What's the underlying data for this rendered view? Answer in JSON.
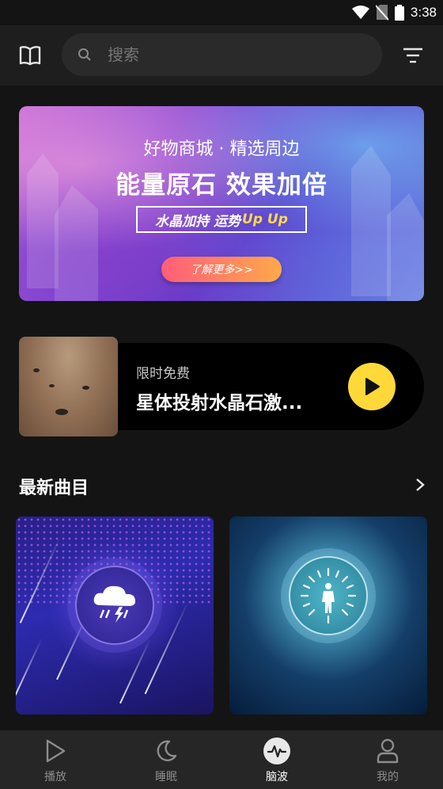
{
  "status_bar": {
    "time": "3:38"
  },
  "header": {
    "book_icon": "book-icon",
    "search_placeholder": "搜索",
    "filter_icon": "filter-icon"
  },
  "banner": {
    "subtitle": "好物商城 · 精选周边",
    "title": "能量原石  效果加倍",
    "tag_text": "水晶加持 运势",
    "tag_highlight": "Up Up",
    "cta": "了解更多>>"
  },
  "featured": {
    "label": "限时免费",
    "title": "星体投射水晶石激...",
    "play_icon": "play-icon"
  },
  "latest": {
    "title": "最新曲目",
    "more_icon": "chevron-right-icon",
    "cards": [
      {
        "icon": "thunderstorm-icon"
      },
      {
        "icon": "meditation-aura-icon"
      }
    ]
  },
  "bottom_nav": {
    "items": [
      {
        "label": "播放",
        "icon": "play-outline-icon",
        "active": false
      },
      {
        "label": "睡眠",
        "icon": "moon-icon",
        "active": false
      },
      {
        "label": "脑波",
        "icon": "brainwave-icon",
        "active": true
      },
      {
        "label": "我的",
        "icon": "user-icon",
        "active": false
      }
    ]
  },
  "colors": {
    "background": "#141414",
    "accent_yellow": "#ffd83a",
    "cta_gradient_start": "#ff5d7a",
    "cta_gradient_end": "#ffa94a"
  }
}
